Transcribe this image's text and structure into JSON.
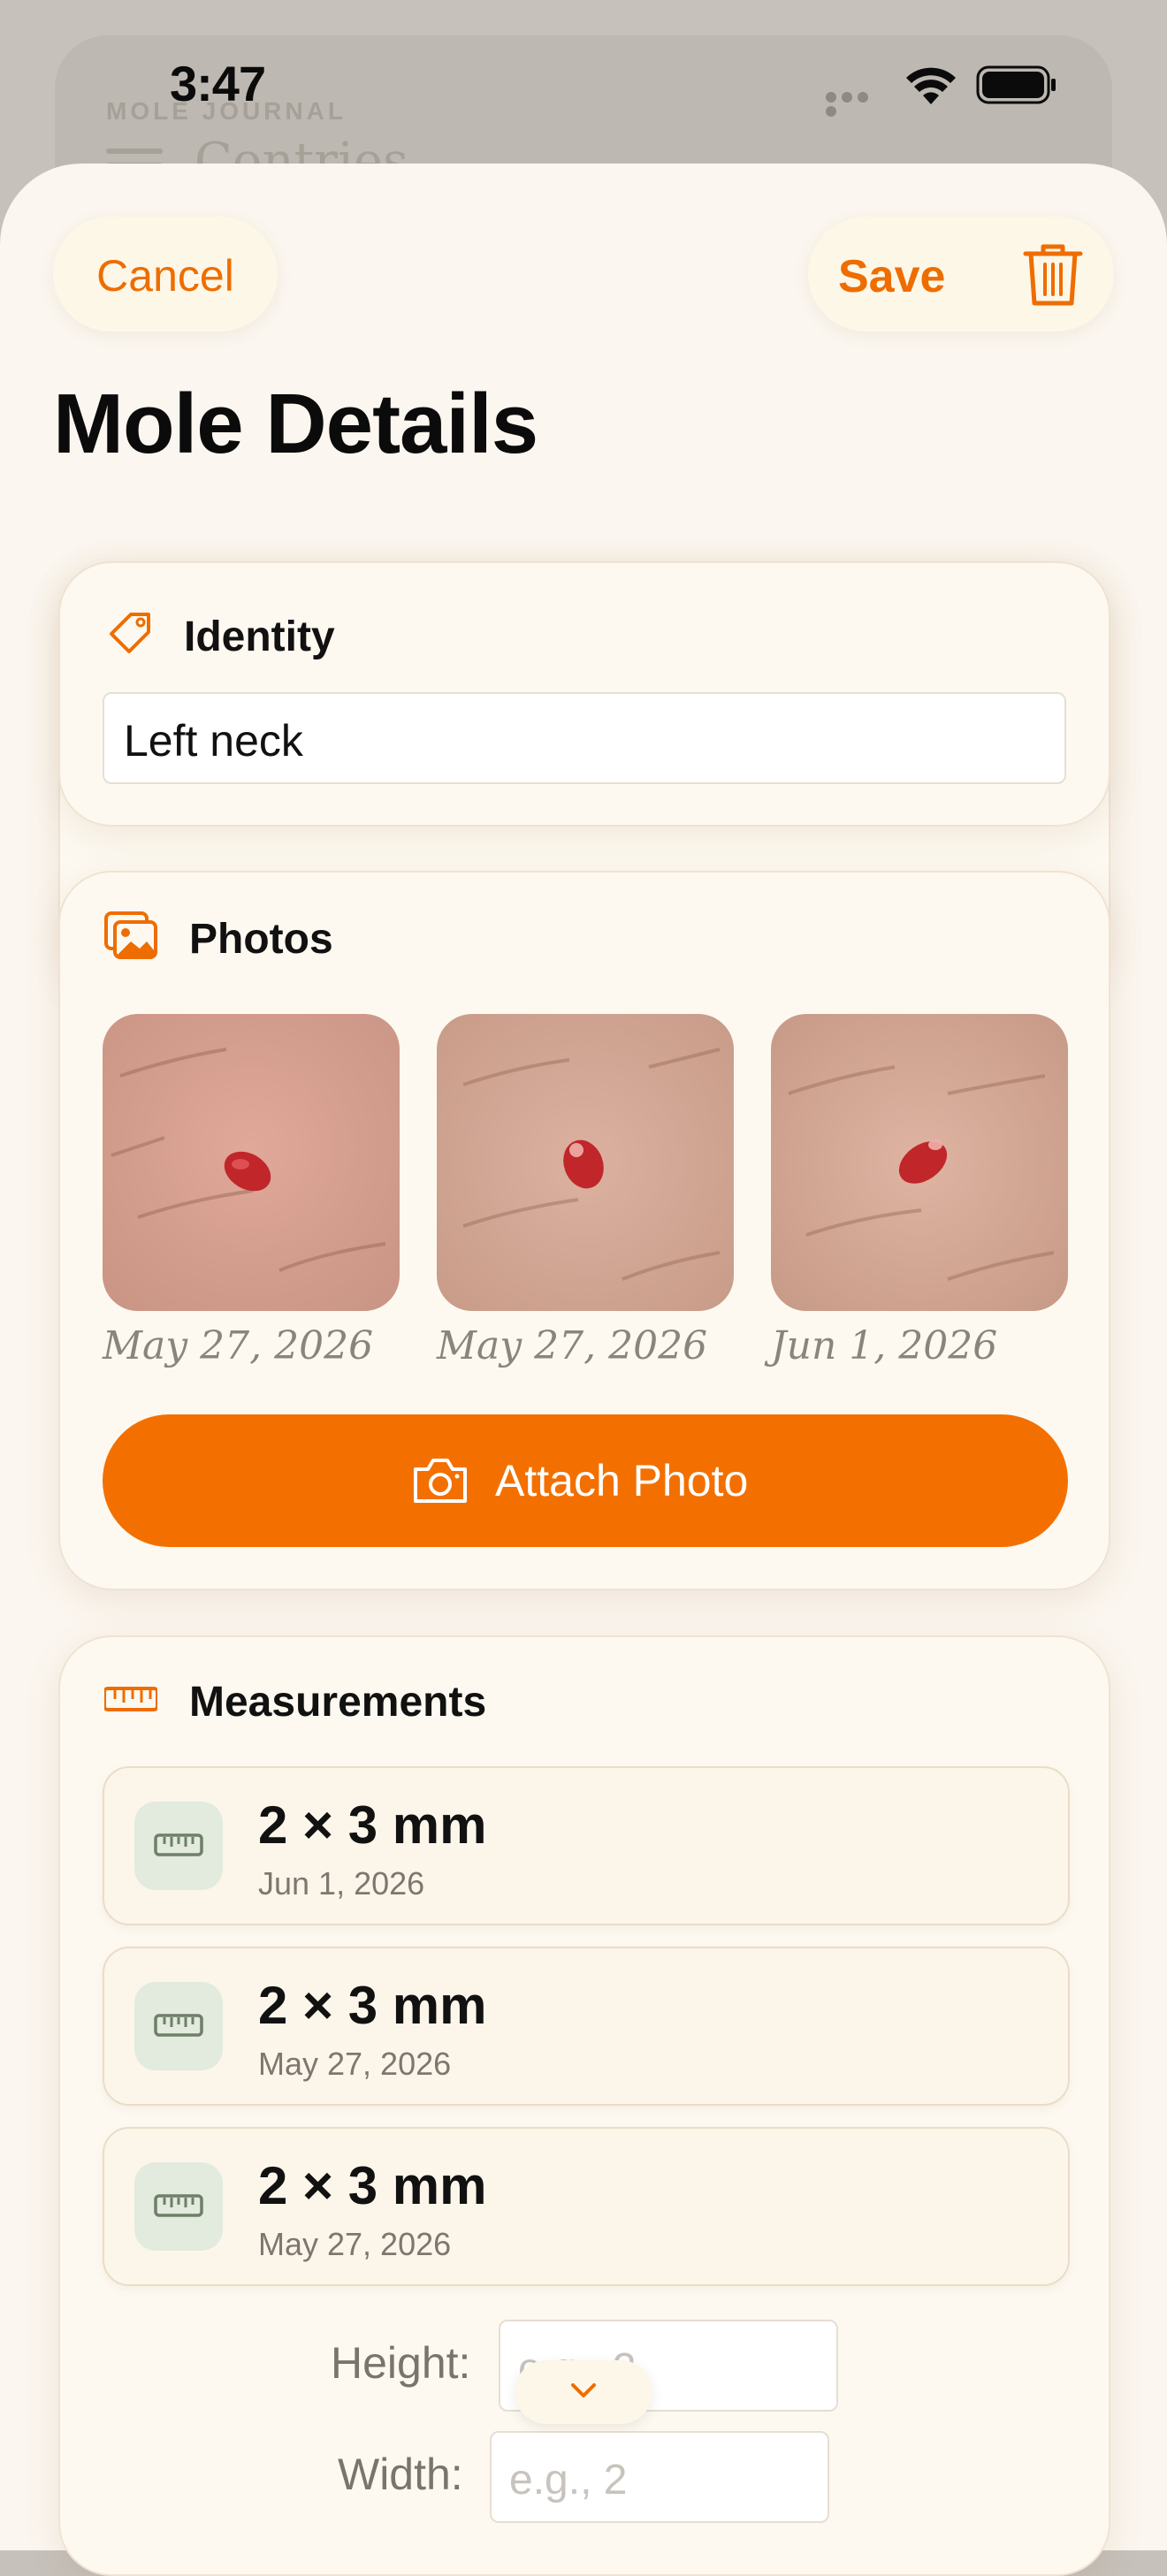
{
  "background_app": {
    "label": "MOLE JOURNAL",
    "title": "Contries"
  },
  "status_bar": {
    "time": "3:47"
  },
  "nav": {
    "cancel_label": "Cancel",
    "save_label": "Save"
  },
  "page_title": "Mole Details",
  "identity": {
    "heading": "Identity",
    "name_value": "Left neck"
  },
  "photos": {
    "heading": "Photos",
    "items": [
      {
        "date": "May 27, 2026"
      },
      {
        "date": "May 27, 2026"
      },
      {
        "date": "Jun 1, 2026"
      }
    ],
    "attach_label": "Attach Photo"
  },
  "measurements": {
    "heading": "Measurements",
    "entries": [
      {
        "value": "2 × 3 mm",
        "date": "Jun 1, 2026"
      },
      {
        "value": "2 × 3 mm",
        "date": "May 27, 2026"
      },
      {
        "value": "2 × 3 mm",
        "date": "May 27, 2026"
      }
    ],
    "height_label": "Height:",
    "height_placeholder": "e.g., 2",
    "width_label": "Width:",
    "width_placeholder": "e.g., 2"
  },
  "colors": {
    "accent": "#F37000",
    "sheet_bg": "#FBF6EF",
    "tile_bg": "#E2EBDD"
  }
}
